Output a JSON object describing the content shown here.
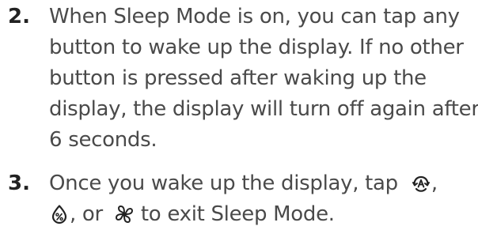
{
  "steps": [
    {
      "number": "2.",
      "lines": [
        "When Sleep Mode is on, you can tap any",
        "button to wake up the display. If no other",
        "button is pressed after waking up the",
        "display, the display will turn off again after",
        "6 seconds."
      ]
    },
    {
      "number": "3.",
      "line1_text": "Once you wake up the display, tap",
      "line1_sep": ",",
      "line2_sep1": ", or",
      "line2_text": "to exit Sleep Mode.",
      "icons": [
        "auto-mode-icon",
        "humidity-icon",
        "fan-icon"
      ]
    }
  ]
}
